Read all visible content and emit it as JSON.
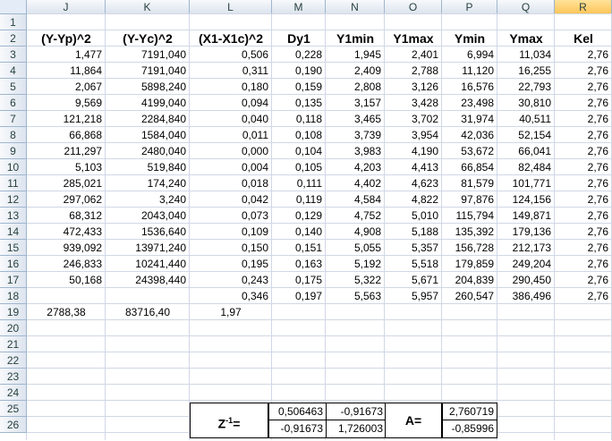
{
  "columns": [
    "J",
    "K",
    "L",
    "M",
    "N",
    "O",
    "P",
    "Q",
    "R"
  ],
  "rows": [
    "1",
    "2",
    "3",
    "4",
    "5",
    "6",
    "7",
    "8",
    "9",
    "10",
    "11",
    "12",
    "13",
    "14",
    "15",
    "16",
    "17",
    "18",
    "19",
    "20",
    "21",
    "22",
    "23",
    "24",
    "25",
    "26"
  ],
  "headers": [
    "(Y-Yp)^2",
    "(Y-Yc)^2",
    "(X1-X1c)^2",
    "Dy1",
    "Y1min",
    "Y1max",
    "Ymin",
    "Ymax",
    "Kel"
  ],
  "table": [
    [
      "1,477",
      "7191,040",
      "0,506",
      "0,228",
      "1,945",
      "2,401",
      "6,994",
      "11,034",
      "2,76"
    ],
    [
      "11,864",
      "7191,040",
      "0,311",
      "0,190",
      "2,409",
      "2,788",
      "11,120",
      "16,255",
      "2,76"
    ],
    [
      "2,067",
      "5898,240",
      "0,180",
      "0,159",
      "2,808",
      "3,126",
      "16,576",
      "22,793",
      "2,76"
    ],
    [
      "9,569",
      "4199,040",
      "0,094",
      "0,135",
      "3,157",
      "3,428",
      "23,498",
      "30,810",
      "2,76"
    ],
    [
      "121,218",
      "2284,840",
      "0,040",
      "0,118",
      "3,465",
      "3,702",
      "31,974",
      "40,511",
      "2,76"
    ],
    [
      "66,868",
      "1584,040",
      "0,011",
      "0,108",
      "3,739",
      "3,954",
      "42,036",
      "52,154",
      "2,76"
    ],
    [
      "211,297",
      "2480,040",
      "0,000",
      "0,104",
      "3,983",
      "4,190",
      "53,672",
      "66,041",
      "2,76"
    ],
    [
      "5,103",
      "519,840",
      "0,004",
      "0,105",
      "4,203",
      "4,413",
      "66,854",
      "82,484",
      "2,76"
    ],
    [
      "285,021",
      "174,240",
      "0,018",
      "0,111",
      "4,402",
      "4,623",
      "81,579",
      "101,771",
      "2,76"
    ],
    [
      "297,062",
      "3,240",
      "0,042",
      "0,119",
      "4,584",
      "4,822",
      "97,876",
      "124,156",
      "2,76"
    ],
    [
      "68,312",
      "2043,040",
      "0,073",
      "0,129",
      "4,752",
      "5,010",
      "115,794",
      "149,871",
      "2,76"
    ],
    [
      "472,433",
      "1536,640",
      "0,109",
      "0,140",
      "4,908",
      "5,188",
      "135,392",
      "179,136",
      "2,76"
    ],
    [
      "939,092",
      "13971,240",
      "0,150",
      "0,151",
      "5,055",
      "5,357",
      "156,728",
      "212,173",
      "2,76"
    ],
    [
      "246,833",
      "10241,440",
      "0,195",
      "0,163",
      "5,192",
      "5,518",
      "179,859",
      "249,204",
      "2,76"
    ],
    [
      "50,168",
      "24398,440",
      "0,243",
      "0,175",
      "5,322",
      "5,671",
      "204,839",
      "290,450",
      "2,76"
    ],
    [
      "",
      "",
      "0,346",
      "0,197",
      "5,563",
      "5,957",
      "260,547",
      "386,496",
      "2,76"
    ]
  ],
  "totals": [
    "2788,38",
    "83716,40",
    "1,97"
  ],
  "z_label_main": "Z",
  "z_label_sup": "-1",
  "z_label_eq": "=",
  "z_matrix": [
    "0,506463",
    "-0,91673",
    "-0,91673",
    "1,726003"
  ],
  "a_label": "A=",
  "a_vector": [
    "2,760719",
    "-0,85996"
  ]
}
